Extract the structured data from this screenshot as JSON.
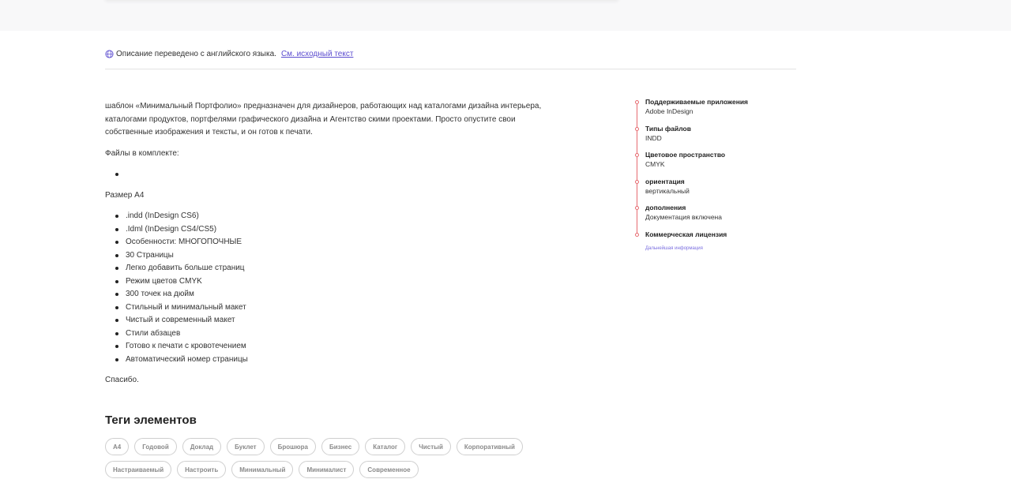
{
  "translation_notice": {
    "text": "Описание переведено с английского языка.",
    "link": "См. исходный текст"
  },
  "description": {
    "intro": "шаблон «Минимальный Портфолио» предназначен для дизайнеров, работающих над каталогами дизайна интерьера, каталогами продуктов, портфелями графического дизайна и Агентство скими проектами. Просто опустите свои собственные изображения и тексты, и он готов к печати.",
    "files_heading": "Файлы в комплекте:",
    "size": "Размер А4",
    "features": [
      ".indd (InDesign CS6)",
      ".Idml (InDesign CS4/CS5)",
      "Особенности: МНОГОПОЧНЫЕ",
      "30 Страницы",
      "Легко добавить больше страниц",
      "Режим цветов CMYK",
      "300 точек на дюйм",
      "Стильный и минимальный макет",
      "Чистый и современный макет",
      "Стили абзацев",
      "Готово к печати с кровотечением",
      "Автоматический номер страницы"
    ],
    "thanks": "Спасибо."
  },
  "tags": {
    "title": "Теги элементов",
    "items": [
      "А4",
      "Годовой",
      "Доклад",
      "Буклет",
      "Брошюра",
      "Бизнес",
      "Каталог",
      "Чистый",
      "Корпоративный",
      "Настраиваемый",
      "Настроить",
      "Минимальный",
      "Минималист",
      "Современное"
    ]
  },
  "attributes": [
    {
      "label": "Поддерживаемые приложения",
      "value": "Adobe InDesign"
    },
    {
      "label": "Типы файлов",
      "value": "INDD"
    },
    {
      "label": "Цветовое пространство",
      "value": "CMYK"
    },
    {
      "label": "ориентация",
      "value": "вертикальный"
    },
    {
      "label": "дополнения",
      "value": "Документация включена"
    },
    {
      "label": "Коммерческая лицензия",
      "value": "",
      "link": "Дальнейшая информация"
    }
  ],
  "colors": {
    "accent": "#e66a70",
    "link": "#5b4ccf",
    "tag_border": "#cfcfcf"
  }
}
